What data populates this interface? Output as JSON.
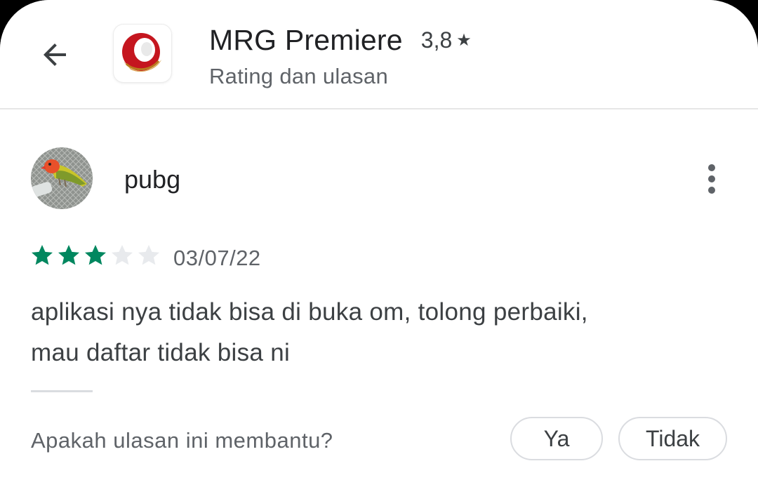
{
  "header": {
    "app_name": "MRG Premiere",
    "rating": "3,8",
    "rating_star": "★",
    "subtitle": "Rating dan ulasan",
    "back_icon": "arrow-back-icon",
    "app_icon": "mrg-premiere-logo"
  },
  "review": {
    "username": "pubg",
    "avatar": "bird-photo-avatar",
    "stars_filled": 3,
    "stars_total": 5,
    "star_color": "#01875f",
    "star_empty_color": "#e8eaed",
    "date": "03/07/22",
    "text_line1": "aplikasi nya tidak bisa di buka om, tolong perbaiki,",
    "text_line2": "mau daftar tidak bisa ni",
    "more_icon": "more-vert-icon"
  },
  "feedback": {
    "question": "Apakah ulasan ini membantu?",
    "yes_label": "Ya",
    "no_label": "Tidak"
  }
}
